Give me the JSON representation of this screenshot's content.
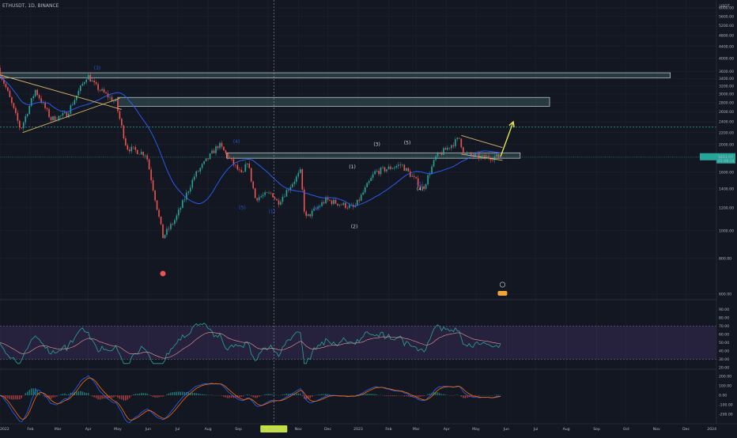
{
  "header": {
    "symbol_title": "ETHUSDT, 1D, BINANCE"
  },
  "colors": {
    "background": "#131722",
    "grid": "#1e222d",
    "text": "#b2b5be",
    "up_candle": "#26a69a",
    "down_candle": "#ef5350",
    "ma_line": "#2962ff",
    "zone_fill": "#3c6464",
    "zone_border": "#d1d4dc",
    "triangle": "#d6b46a",
    "projection_arrow": "#e6e64a",
    "price_label_bg": "#26a69a",
    "rsi_band": "#7e57c2",
    "rsi_line": "#26a69a",
    "rsi_ma": "#ef9a9a",
    "macd_line": "#2962ff",
    "signal_line": "#ff6d00",
    "cursor_label_bg": "#c6e23a",
    "wave_minor": "#2962ff",
    "wave_major": "#d1d4dc"
  },
  "price_axis": {
    "unit": "USDT",
    "ticks": [
      "6000.00",
      "5600.00",
      "5200.00",
      "4800.00",
      "4400.00",
      "4000.00",
      "3600.00",
      "3400.00",
      "3200.00",
      "3000.00",
      "2800.00",
      "2600.00",
      "2400.00",
      "2200.00",
      "2000.00",
      "1800.00",
      "1600.00",
      "1400.00",
      "1200.00",
      "1000.00",
      "800.00",
      "600.00"
    ],
    "current_price_label": "1811.97",
    "current_price_sublabel": "01:06:14"
  },
  "rsi_axis": {
    "ticks": [
      "90.00",
      "80.00",
      "70.00",
      "60.00",
      "50.00",
      "40.00",
      "30.00",
      "20.00"
    ]
  },
  "macd_axis": {
    "ticks": [
      "200.00",
      "100.00",
      "0.00",
      "-100.00",
      "-200.00"
    ]
  },
  "time_axis": {
    "labels": [
      "2022",
      "Feb",
      "Mar",
      "Apr",
      "May",
      "Jun",
      "Jul",
      "Aug",
      "Sep",
      "Oct",
      "Nov",
      "Dec",
      "2023",
      "Feb",
      "Mar",
      "Apr",
      "May",
      "Jun",
      "Jul",
      "Aug",
      "Sep",
      "Oct",
      "Nov",
      "Dec",
      "2024"
    ],
    "cursor_date": "Fri 07 Oct '22"
  },
  "wave_labels": {
    "major": [
      "(1)",
      "(2)",
      "(3)",
      "(4)",
      "(5)"
    ],
    "minor": [
      "(3)",
      "(4)",
      "(5)",
      "(1)",
      "(2)",
      "(1)"
    ]
  },
  "chart_data": {
    "type": "candlestick",
    "symbol": "ETHUSDT",
    "timeframe": "1D",
    "exchange": "BINANCE",
    "x_range": [
      "2022-01-01",
      "2024-01-01"
    ],
    "price_ylim": [
      600,
      6000
    ],
    "price_scale": "log",
    "price_path": [
      [
        "2022-01-01",
        3700
      ],
      [
        "2022-01-10",
        3100
      ],
      [
        "2022-01-24",
        2250
      ],
      [
        "2022-02-08",
        3100
      ],
      [
        "2022-02-24",
        2450
      ],
      [
        "2022-03-12",
        2550
      ],
      [
        "2022-04-02",
        3500
      ],
      [
        "2022-04-10",
        3200
      ],
      [
        "2022-05-01",
        2800
      ],
      [
        "2022-05-12",
        1950
      ],
      [
        "2022-06-01",
        1850
      ],
      [
        "2022-06-18",
        950
      ],
      [
        "2022-07-01",
        1100
      ],
      [
        "2022-07-20",
        1550
      ],
      [
        "2022-08-14",
        2000
      ],
      [
        "2022-09-07",
        1550
      ],
      [
        "2022-09-12",
        1750
      ],
      [
        "2022-09-20",
        1300
      ],
      [
        "2022-10-07",
        1350
      ],
      [
        "2022-10-13",
        1250
      ],
      [
        "2022-11-05",
        1600
      ],
      [
        "2022-11-10",
        1100
      ],
      [
        "2022-12-01",
        1280
      ],
      [
        "2022-12-30",
        1200
      ],
      [
        "2023-01-20",
        1600
      ],
      [
        "2023-02-16",
        1700
      ],
      [
        "2023-03-10",
        1400
      ],
      [
        "2023-03-23",
        1800
      ],
      [
        "2023-04-16",
        2100
      ],
      [
        "2023-04-21",
        1850
      ],
      [
        "2023-05-10",
        1800
      ],
      [
        "2023-05-26",
        1812
      ]
    ],
    "resistance_zones": [
      {
        "start": "2022-01-01",
        "end": "2023-11-15",
        "low": 3420,
        "high": 3560
      },
      {
        "start": "2022-05-01",
        "end": "2023-07-15",
        "low": 2720,
        "high": 2920
      },
      {
        "start": "2022-08-20",
        "end": "2023-06-15",
        "low": 1790,
        "high": 1870
      }
    ],
    "triangles": [
      {
        "apex_start": [
          "2022-01-01",
          3500
        ],
        "upper_end": [
          "2022-05-05",
          2650
        ],
        "lower_start": [
          "2022-01-24",
          2200
        ],
        "lower_end": [
          "2022-05-03",
          2900
        ]
      },
      {
        "upper": [
          [
            "2023-04-16",
            2150
          ],
          [
            "2023-05-28",
            1950
          ]
        ],
        "lower": [
          [
            "2023-04-16",
            1850
          ],
          [
            "2023-05-28",
            1760
          ]
        ]
      }
    ],
    "projection": {
      "from": [
        "2023-05-26",
        1812
      ],
      "to": [
        "2023-06-08",
        2400
      ]
    },
    "dashed_level": 2300,
    "current_price": 1811.97,
    "rsi": {
      "ylim": [
        20,
        100
      ],
      "band": [
        30,
        70
      ],
      "last": 46
    },
    "macd": {
      "ylim": [
        -250,
        250
      ],
      "last": 10
    }
  }
}
